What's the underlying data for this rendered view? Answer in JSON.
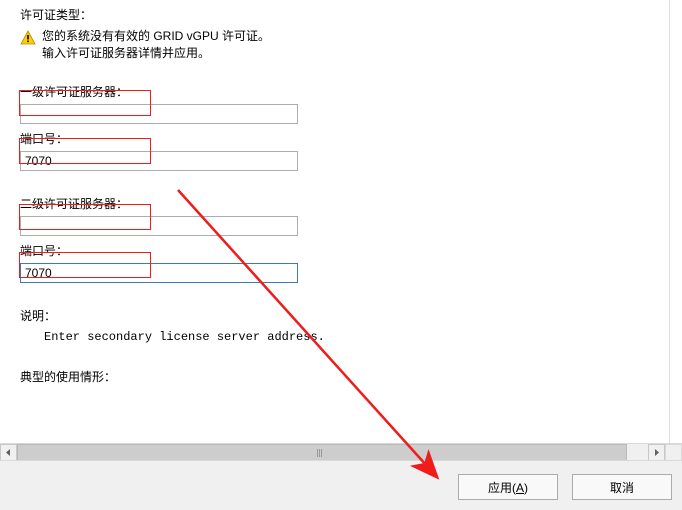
{
  "header": {
    "license_type_label": "许可证类型：",
    "warning_line1": "您的系统没有有效的 GRID vGPU 许可证。",
    "warning_line2": "输入许可证服务器详情并应用。"
  },
  "primary": {
    "server_label": "一级许可证服务器：",
    "server_value": "",
    "port_label": "端口号：",
    "port_value": "7070"
  },
  "secondary": {
    "server_label": "二级许可证服务器：",
    "server_value": "",
    "port_label": "端口号：",
    "port_value": "7070"
  },
  "description": {
    "label": "说明：",
    "text": "Enter secondary license server address."
  },
  "typical_usage_label": "典型的使用情形：",
  "buttons": {
    "apply": "应用",
    "apply_mnemonic": "A",
    "cancel": "取消"
  },
  "annotation_color": "#ef1c1c"
}
